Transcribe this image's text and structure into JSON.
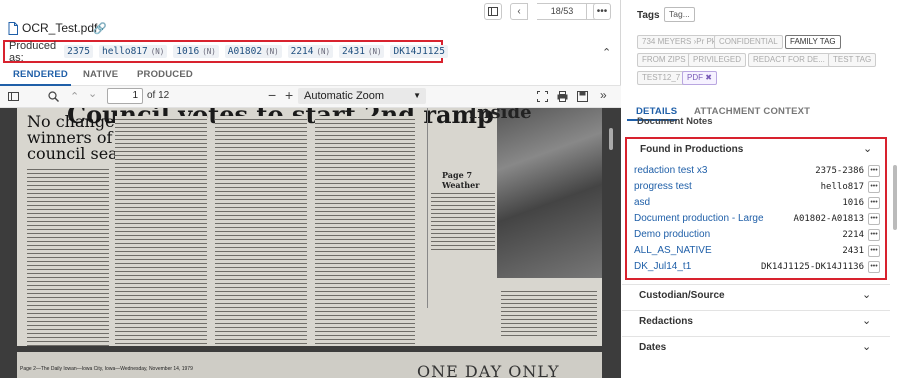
{
  "document": {
    "file_name": "OCR_Test.pdf",
    "page_indicator": "18/53"
  },
  "produced_as": {
    "label": "Produced as:",
    "chips": [
      {
        "value": "2375",
        "suffix": ""
      },
      {
        "value": "hello817",
        "suffix": "(N)"
      },
      {
        "value": "1016",
        "suffix": "(N)"
      },
      {
        "value": "A01802",
        "suffix": "(N)"
      },
      {
        "value": "2214",
        "suffix": "(N)"
      },
      {
        "value": "2431",
        "suffix": "(N)"
      },
      {
        "value": "DK14J1125",
        "suffix": ""
      }
    ]
  },
  "viewer_tabs": [
    "RENDERED",
    "NATIVE",
    "PRODUCED"
  ],
  "pdf_toolbar": {
    "page": "1",
    "of_pages": "of 12",
    "zoom": "Automatic Zoom"
  },
  "scan": {
    "headline": "Council votes to start 2nd ramp",
    "subhead": [
      "No change in",
      "winners of",
      "council seats"
    ],
    "inside": "Inside",
    "weather": "Weather",
    "page_label": "Page 7",
    "page2_text": "ONE DAY ONLY",
    "footer": "Page 2—The Daily Iowan—Iowa City, Iowa—Wednesday, November 14, 1979"
  },
  "tags": {
    "label": "Tags",
    "add_label": "Tag...",
    "items": [
      {
        "label": "734 MEYERS ›Pr Pk"
      },
      {
        "label": "CONFIDENTIAL"
      },
      {
        "label": "FAMILY TAG"
      },
      {
        "label": "FROM ZIPS"
      },
      {
        "label": "PRIVILEGED"
      },
      {
        "label": "REDACT FOR DE..."
      },
      {
        "label": "TEST TAG"
      },
      {
        "label": "TEST12_7"
      },
      {
        "label": "PDF ✖"
      }
    ]
  },
  "details_tabs": [
    "DETAILS",
    "ATTACHMENT CONTEXT"
  ],
  "document_notes": "Document Notes",
  "found_in_productions": {
    "title": "Found in Productions",
    "rows": [
      {
        "name": "redaction test x3",
        "value": "2375-2386"
      },
      {
        "name": "progress test",
        "value": "hello817"
      },
      {
        "name": "asd",
        "value": "1016"
      },
      {
        "name": "Document production - Large",
        "value": "A01802-A01813"
      },
      {
        "name": "Demo production",
        "value": "2214"
      },
      {
        "name": "ALL_AS_NATIVE",
        "value": "2431"
      },
      {
        "name": "DK_Jul14_t1",
        "value": "DK14J1125-DK14J1136"
      }
    ]
  },
  "sections": [
    "Custodian/Source",
    "Redactions",
    "Dates"
  ],
  "colors": {
    "accent": "#1f5fa8",
    "highlight": "#d8222e"
  }
}
